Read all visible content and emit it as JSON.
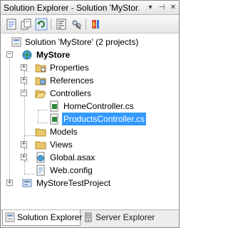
{
  "title_bar": {
    "title": "Solution Explorer - Solution 'MyStor...",
    "dropdown_glyph": "▾",
    "pin_glyph": "⊣",
    "close_glyph": "✕"
  },
  "toolbar": {
    "buttons": [
      "properties-icon",
      "show-all-files-icon",
      "refresh-icon",
      "view-code-icon",
      "view-designer-icon",
      "class-diagram-icon"
    ]
  },
  "tree": {
    "solution": "Solution 'MyStore' (2 projects)",
    "project": "MyStore",
    "properties": "Properties",
    "references": "References",
    "controllers": "Controllers",
    "home_controller": "HomeController.cs",
    "products_controller": "ProductsController.cs",
    "models": "Models",
    "views": "Views",
    "global": "Global.asax",
    "webconfig": "Web.config",
    "test_project": "MyStoreTestProject",
    "plus": "+",
    "minus": "−"
  },
  "tabs": {
    "solution_explorer": "Solution Explorer",
    "server_explorer": "Server Explorer"
  },
  "colors": {
    "selection": "#3399ff",
    "folder": "#e8c66a",
    "cs_file": "#2e8b3d"
  }
}
